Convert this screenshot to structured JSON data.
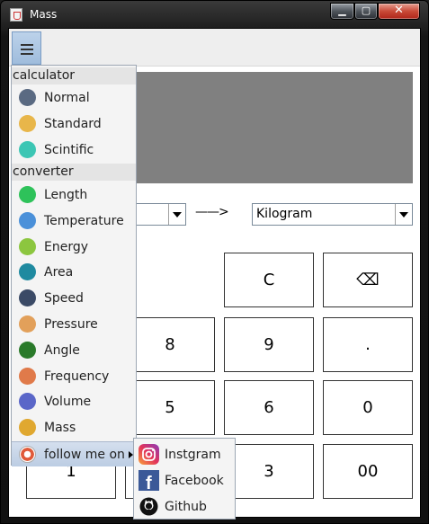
{
  "window": {
    "title": "Mass",
    "minimize_glyph": "▁",
    "maximize_glyph": "▢",
    "close_glyph": "✕"
  },
  "converter": {
    "from_unit": "",
    "arrow": "——>",
    "to_unit": "Kilogram"
  },
  "keypad": {
    "clear": "C",
    "backspace": "⌫",
    "keys": [
      "8",
      "9",
      ".",
      "5",
      "6",
      "0",
      "1",
      "3",
      "00"
    ]
  },
  "menu": {
    "calculator_header": "calculator",
    "calculator_items": [
      {
        "label": "Normal",
        "icon": "normal-calculator-icon",
        "color": "#5a6a82"
      },
      {
        "label": "Standard",
        "icon": "standard-calculator-icon",
        "color": "#e8b64a"
      },
      {
        "label": "Scintific",
        "icon": "scientific-calculator-icon",
        "color": "#3cc6b4"
      }
    ],
    "converter_header": "converter",
    "converter_items": [
      {
        "label": "Length",
        "icon": "ruler-icon",
        "color": "#2ec25a"
      },
      {
        "label": "Temperature",
        "icon": "thermometer-icon",
        "color": "#4a90d9"
      },
      {
        "label": "Energy",
        "icon": "lightning-icon",
        "color": "#8cc63f"
      },
      {
        "label": "Area",
        "icon": "location-pin-icon",
        "color": "#1f8aa0"
      },
      {
        "label": "Speed",
        "icon": "speedometer-icon",
        "color": "#3b4a66"
      },
      {
        "label": "Pressure",
        "icon": "pressure-gauge-icon",
        "color": "#e2a05a"
      },
      {
        "label": "Angle",
        "icon": "angle-icon",
        "color": "#2a7a2a"
      },
      {
        "label": "Frequency",
        "icon": "frequency-wave-icon",
        "color": "#e07a4a"
      },
      {
        "label": "Volume",
        "icon": "volume-cylinder-icon",
        "color": "#5a66c8"
      },
      {
        "label": "Mass",
        "icon": "weight-icon",
        "color": "#e0a830"
      }
    ],
    "follow_label": "follow me on",
    "follow_icon": "lifebuoy-icon",
    "social": [
      {
        "label": "Instgram",
        "icon": "instagram-icon"
      },
      {
        "label": "Facebook",
        "icon": "facebook-icon"
      },
      {
        "label": "Github",
        "icon": "github-icon"
      }
    ]
  },
  "colors": {
    "display_bg": "#808080",
    "menu_highlight": "#c4d4e8",
    "facebook": "#3b5998",
    "instagram": "#c13584"
  }
}
